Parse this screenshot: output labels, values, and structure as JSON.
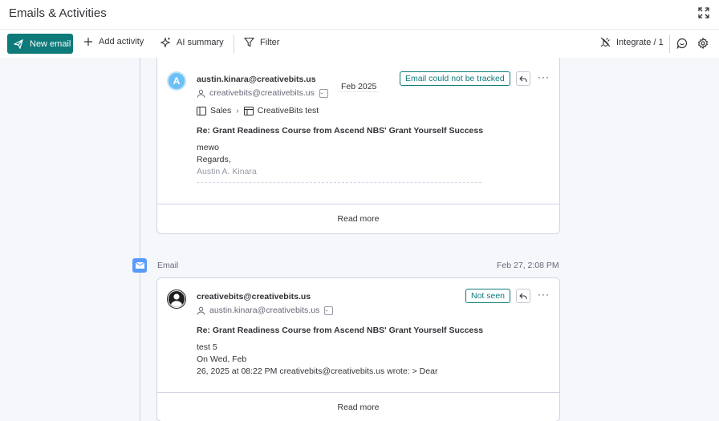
{
  "header": {
    "title": "Emails & Activities",
    "expand_icon": "expand-icon"
  },
  "toolbar": {
    "new_email": "New email",
    "add_activity": "Add activity",
    "ai_summary": "AI summary",
    "filter": "Filter",
    "integrate": "Integrate / 1",
    "accent": "#0f7a7a"
  },
  "email1": {
    "avatar_letter": "A",
    "from": "austin.kinara@creativebits.us",
    "to": "creativebits@creativebits.us",
    "date": "Feb 2025",
    "status": "Email could not be tracked",
    "breadcrumb": [
      "Sales",
      "CreativeBits test"
    ],
    "subject": "Re: Grant Readiness Course from Ascend NBS' Grant Yourself Success",
    "body": [
      "mewo",
      "Regards,",
      "Austin A. Kinara"
    ],
    "read_more": "Read more"
  },
  "timeline": {
    "label": "Email",
    "date": "Feb 27, 2:08 PM",
    "icon_color": "#579bfc"
  },
  "email2": {
    "from": "creativebits@creativebits.us",
    "to": "austin.kinara@creativebits.us",
    "status": "Not seen",
    "subject": "Re: Grant Readiness Course from Ascend NBS' Grant Yourself Success",
    "body": [
      "test 5",
      "On Wed, Feb",
      "26, 2025 at 08:22 PM creativebits@creativebits.us wrote: > Dear"
    ],
    "read_more": "Read more"
  }
}
